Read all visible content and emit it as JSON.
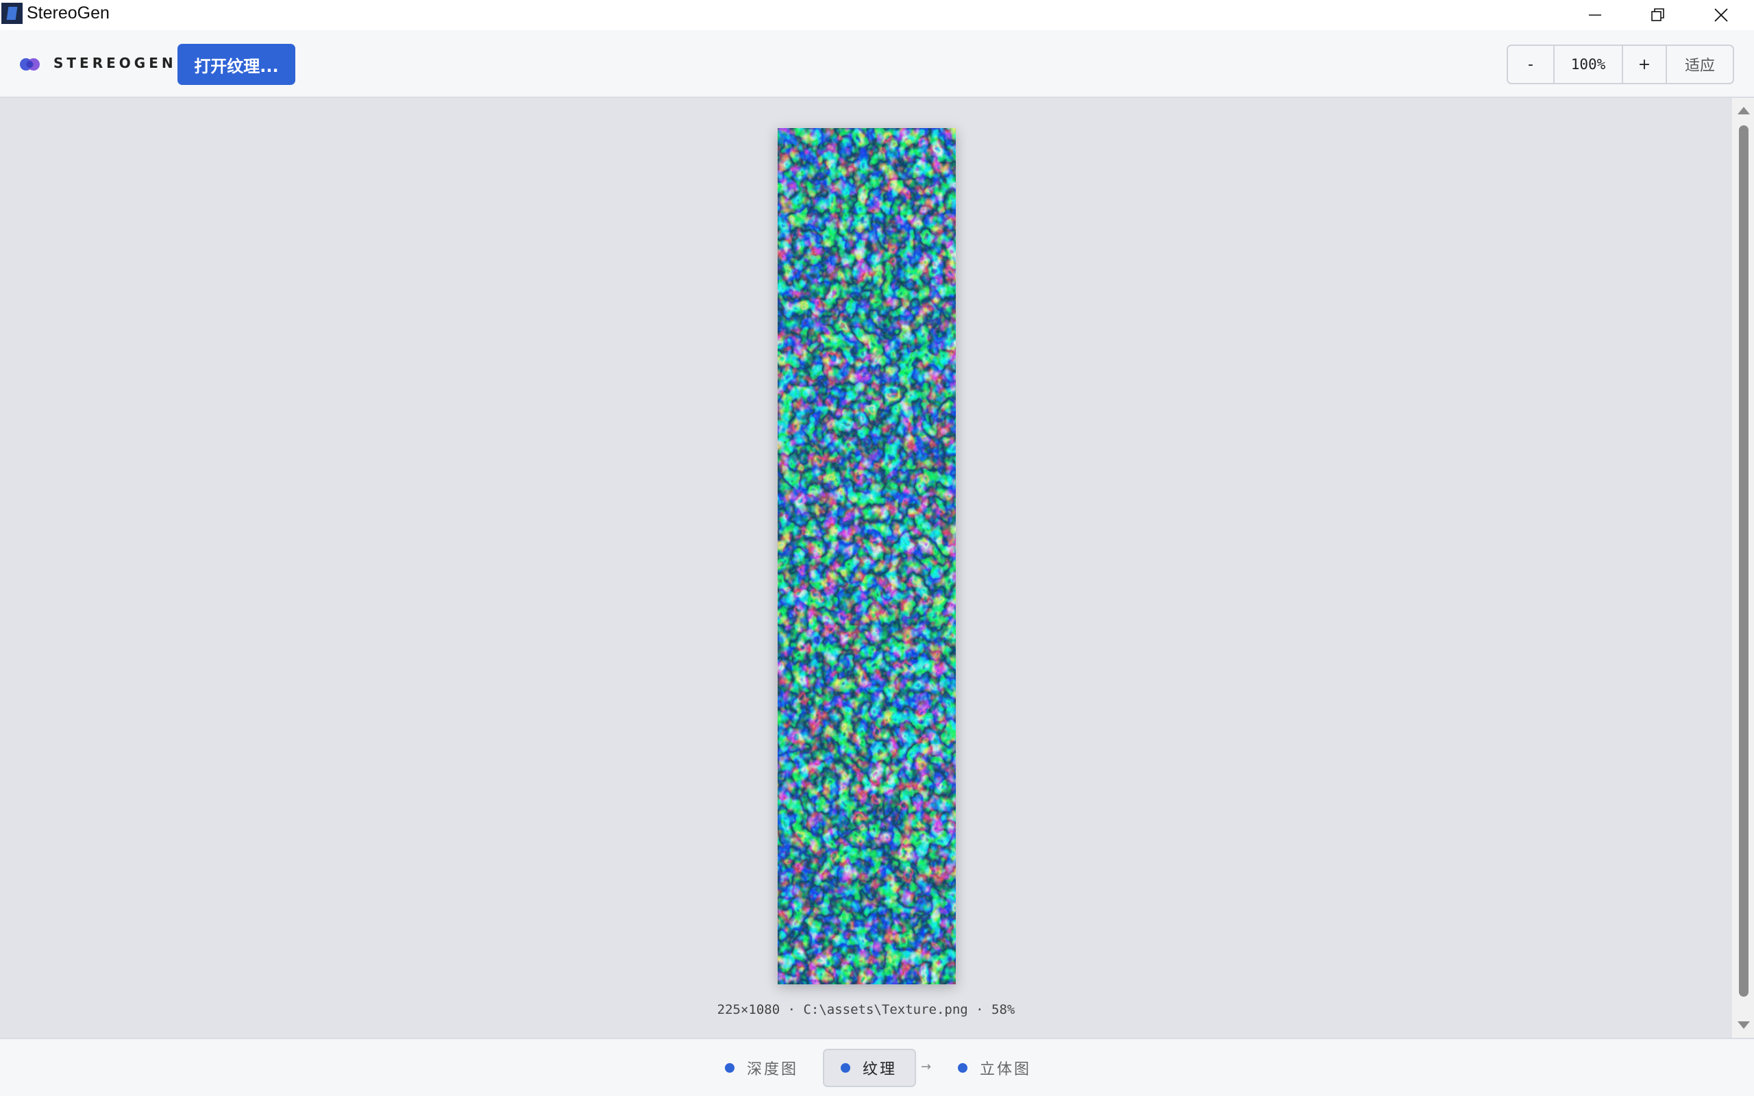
{
  "window": {
    "title": "StereoGen"
  },
  "toolbar": {
    "brand": "STEREOGEN",
    "open_button": "打开纹理...",
    "zoom_out": "-",
    "zoom_level": "100%",
    "zoom_in": "+",
    "fit": "适应"
  },
  "canvas": {
    "image_info": "225×1080 · C:\\assets\\Texture.png · 58%"
  },
  "steps": [
    {
      "label": "深度图",
      "active": false
    },
    {
      "label": "纹理",
      "active": true
    },
    {
      "label": "立体图",
      "active": false
    }
  ],
  "step_arrow": "→",
  "colors": {
    "accent": "#2f64d6",
    "texture_dark": "#0a3a5c",
    "texture_mid": "#1e9fb3",
    "texture_light": "#cdf7f2"
  },
  "icons": {
    "minimize": "minimize-icon",
    "restore": "restore-icon",
    "close": "close-icon"
  }
}
